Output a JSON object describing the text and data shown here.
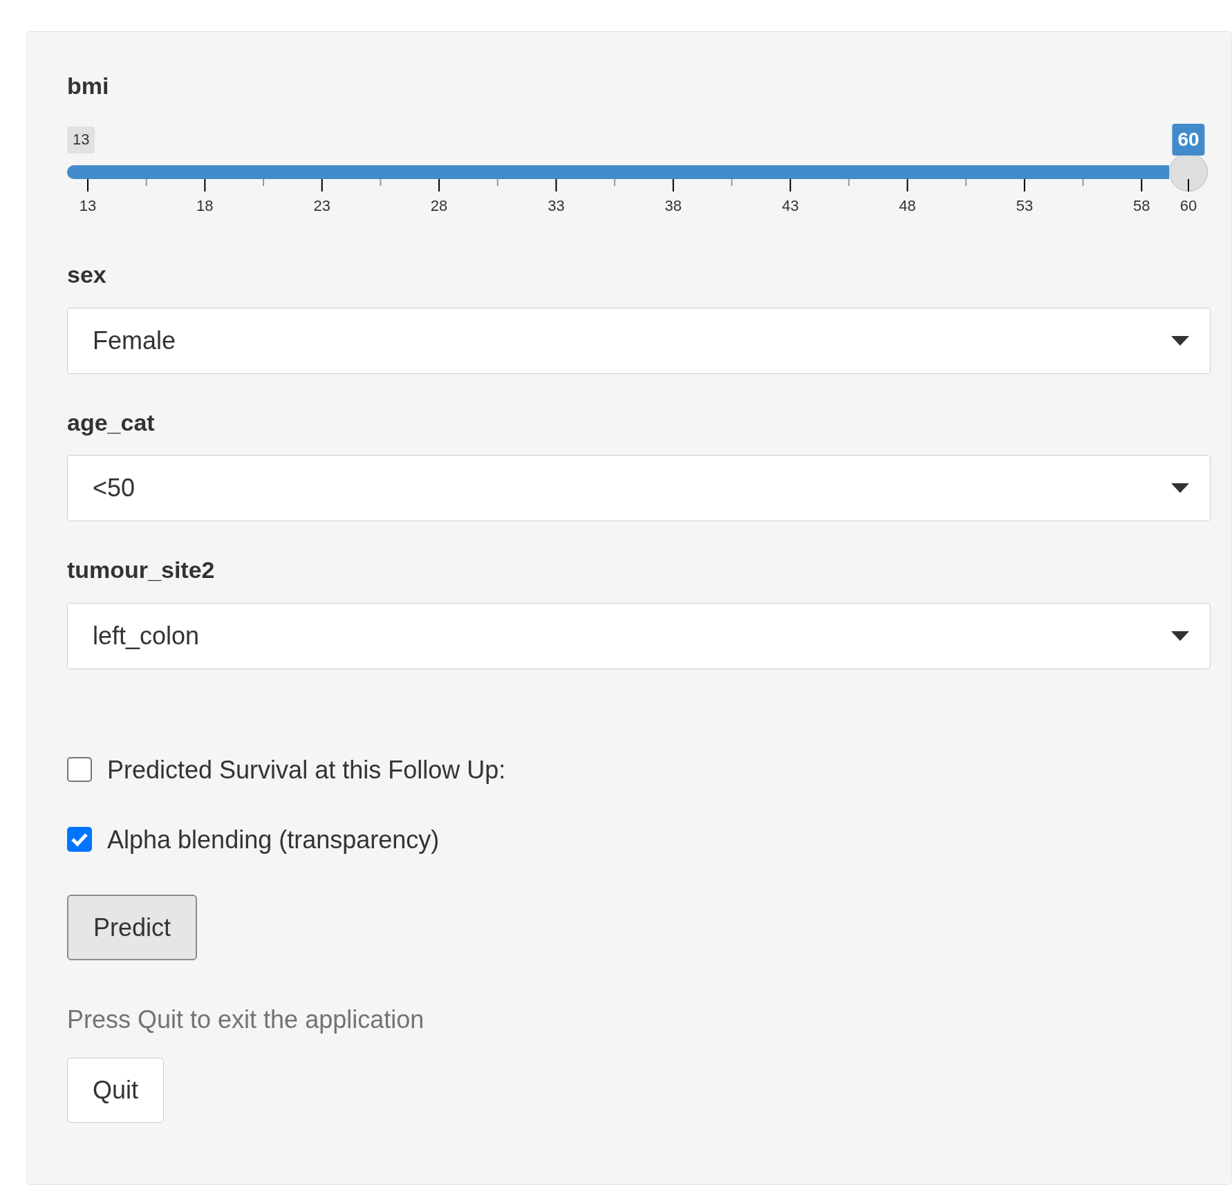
{
  "inputs": [
    {
      "kind": "slider",
      "label": "bmi",
      "min_label": "13",
      "max_label": "60",
      "level": 1,
      "ticks": [
        "13",
        "18",
        "23",
        "28",
        "33",
        "38",
        "43",
        "48",
        "53",
        "58",
        "60"
      ]
    },
    {
      "kind": "select",
      "label": "sex",
      "value": "Female"
    },
    {
      "kind": "select",
      "label": "age_cat",
      "value": "<50"
    },
    {
      "kind": "select",
      "label": "tumour_site2",
      "value": "left_colon"
    }
  ],
  "checkboxes": [
    {
      "label": "Predicted Survival at this Follow Up:",
      "checked": false
    },
    {
      "label": "Alpha blending (transparency)",
      "checked": true
    }
  ],
  "predict_button": "Predict",
  "help_text": "Press Quit to exit the application",
  "quit_button": "Quit"
}
